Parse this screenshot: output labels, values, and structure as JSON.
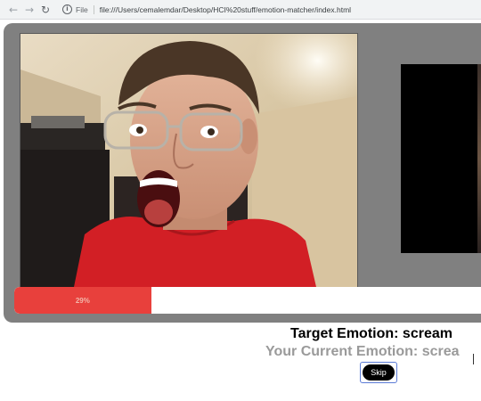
{
  "browser": {
    "back_icon": "arrow-left-icon",
    "forward_icon": "arrow-right-icon",
    "reload_icon": "reload-icon",
    "info_icon": "info-icon",
    "scheme_label": "File",
    "url": "file:///Users/cemalemdar/Desktop/HCI%20stuff/emotion-matcher/index.html"
  },
  "webcam": {
    "feed": "webcam-feed"
  },
  "progress": {
    "value": 0.29,
    "label": "29%",
    "color": "#e8403c"
  },
  "target": {
    "text": "Target Emotion: scream"
  },
  "current": {
    "text": "Your Current Emotion: screa"
  },
  "skip": {
    "label": "Skip"
  }
}
